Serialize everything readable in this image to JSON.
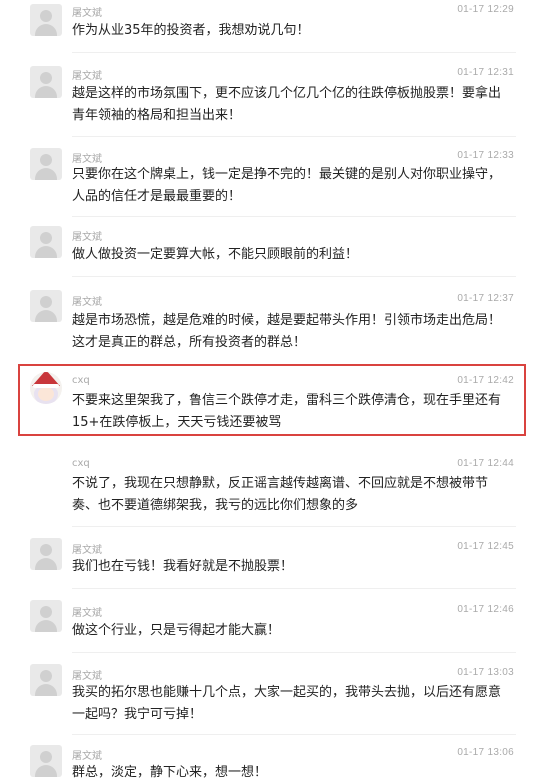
{
  "messages": [
    {
      "name": "屠文斌",
      "time": "01-17 12:29",
      "lines": [
        "作为从业35年的投资者，我想劝说几句！"
      ]
    },
    {
      "name": "屠文斌",
      "time": "01-17 12:31",
      "lines": [
        "越是这样的市场氛围下，更不应该几个亿几个亿的往跌停板抛股票！要拿出",
        "青年领袖的格局和担当出来！"
      ]
    },
    {
      "name": "屠文斌",
      "time": "01-17 12:33",
      "lines": [
        "只要你在这个牌桌上，钱一定是挣不完的！最关键的是别人对你职业操守，",
        "人品的信任才是最最重要的！"
      ]
    },
    {
      "name": "屠文斌",
      "time": "",
      "lines": [
        "做人做投资一定要算大帐，不能只顾眼前的利益！"
      ]
    },
    {
      "name": "屠文斌",
      "time": "01-17 12:37",
      "lines": [
        "越是市场恐慌，越是危难的时候，越是要起带头作用！引领市场走出危局！",
        "这才是真正的群总，所有投资者的群总！"
      ]
    },
    {
      "name": "cxq",
      "time": "01-17 12:42",
      "lines": [
        "不要来这里架我了，鲁信三个跌停才走，雷科三个跌停清仓，现在手里还有",
        "15+在跌停板上，天天亏钱还要被骂"
      ]
    },
    {
      "name": "cxq",
      "time": "01-17 12:44",
      "lines": [
        "不说了，我现在只想静默，反正谣言越传越离谱、不回应就是不想被带节",
        "奏、也不要道德绑架我，我亏的远比你们想象的多"
      ]
    },
    {
      "name": "屠文斌",
      "time": "01-17 12:45",
      "lines": [
        "我们也在亏钱！我看好就是不抛股票！"
      ]
    },
    {
      "name": "屠文斌",
      "time": "01-17 12:46",
      "lines": [
        "做这个行业，只是亏得起才能大赢！"
      ]
    },
    {
      "name": "屠文斌",
      "time": "01-17 13:03",
      "lines": [
        "我买的拓尔思也能赚十几个点，大家一起买的，我带头去抛，以后还有愿意",
        "一起吗？我宁可亏掉！"
      ]
    },
    {
      "name": "屠文斌",
      "time": "01-17 13:06",
      "lines": [
        "群总，淡定，静下心来，想一想！"
      ]
    }
  ]
}
